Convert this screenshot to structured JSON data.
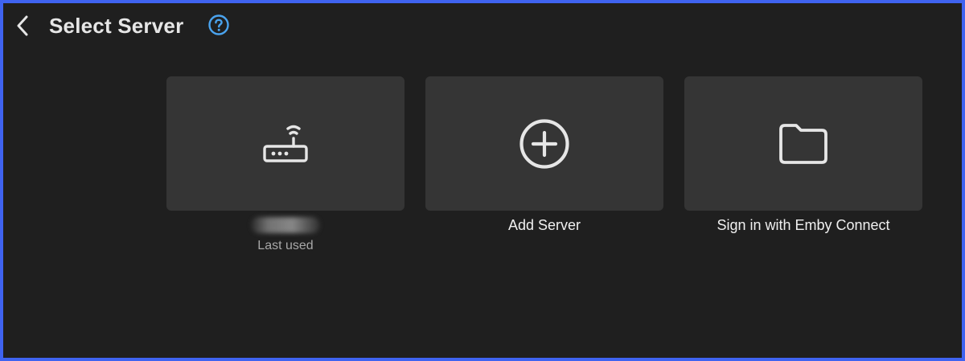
{
  "header": {
    "title": "Select Server",
    "back_icon": "chevron-left-icon",
    "help_icon": "help-circle-icon"
  },
  "colors": {
    "frame_border": "#3f63f0",
    "background": "#1f1f1f",
    "card": "#353535",
    "help_accent": "#4aa3ee"
  },
  "cards": [
    {
      "icon": "router-icon",
      "label": "",
      "label_blurred": true,
      "sublabel": "Last used"
    },
    {
      "icon": "plus-circle-icon",
      "label": "Add Server"
    },
    {
      "icon": "folder-icon",
      "label": "Sign in with Emby Connect"
    }
  ]
}
